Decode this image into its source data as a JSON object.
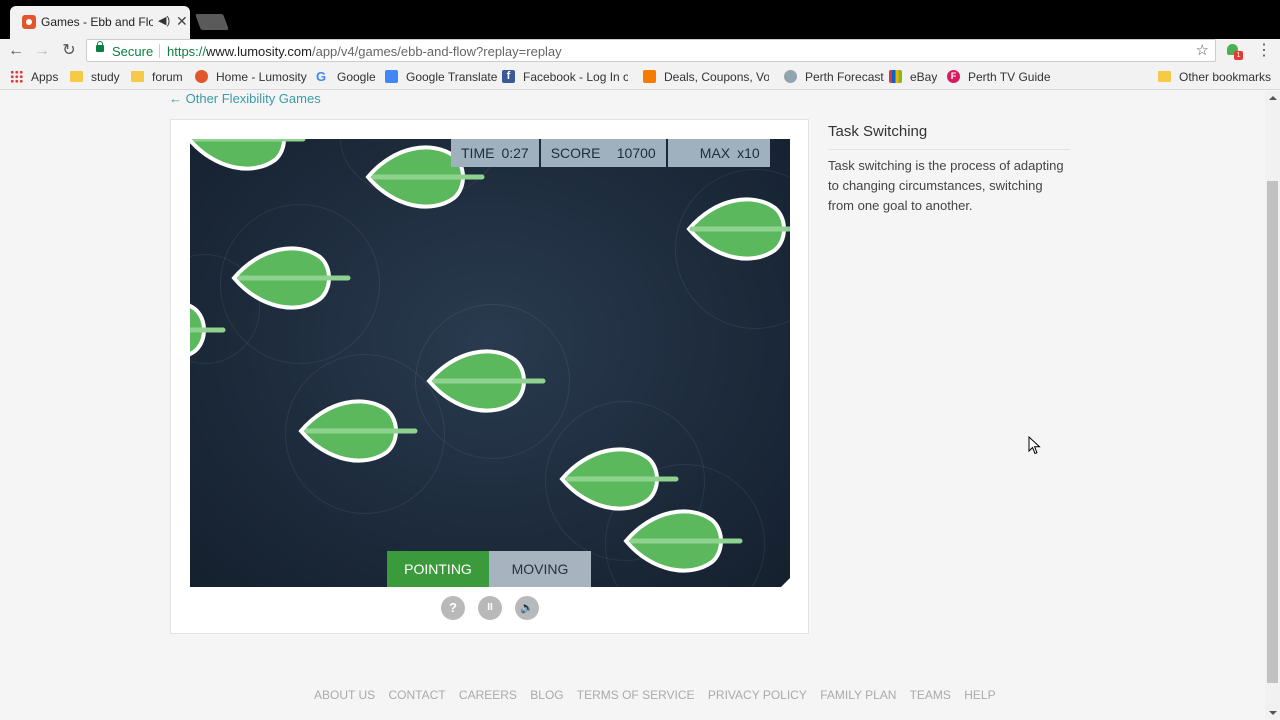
{
  "browser": {
    "tab_title": "Games - Ebb and Flow",
    "tab_audio_icon": "speaker-icon",
    "secure_label": "Secure",
    "url_scheme": "https://",
    "url_host": "www.lumosity.com",
    "url_path": "/app/v4/games/ebb-and-flow?replay=replay",
    "bookmarks": [
      {
        "label": "Apps",
        "icon": "apps"
      },
      {
        "label": "study",
        "icon": "folder"
      },
      {
        "label": "forum",
        "icon": "folder"
      },
      {
        "label": "Home - Lumosity",
        "icon": "lum"
      },
      {
        "label": "Google",
        "icon": "g"
      },
      {
        "label": "Google Translate",
        "icon": "gt"
      },
      {
        "label": "Facebook - Log In or",
        "icon": "fb"
      },
      {
        "label": "Deals, Coupons, Vouc",
        "icon": "oz"
      },
      {
        "label": "Perth Forecast",
        "icon": "perth"
      },
      {
        "label": "eBay",
        "icon": "ebay"
      },
      {
        "label": "Perth TV Guide",
        "icon": "tv"
      }
    ],
    "other_bookmarks": "Other bookmarks",
    "extension_badge": "1"
  },
  "page": {
    "back_link": "← Other Flexibility Games",
    "hud": {
      "time_label": "TIME",
      "time_value": "0:27",
      "score_label": "SCORE",
      "score_value": "10700",
      "max_label": "MAX",
      "max_value": "x10"
    },
    "modes": {
      "pointing": "POINTING",
      "moving": "MOVING"
    },
    "controls": {
      "help": "?",
      "pause": "II",
      "sound": "🔊"
    },
    "side": {
      "title": "Task Switching",
      "description": "Task switching is the process of adapting to changing circumstances, switching from one goal to another."
    },
    "footer": [
      "ABOUT US",
      "CONTACT",
      "CAREERS",
      "BLOG",
      "TERMS OF SERVICE",
      "PRIVACY POLICY",
      "FAMILY PLAN",
      "TEAMS",
      "HELP"
    ]
  },
  "colors": {
    "leaf_green": "#5cb85c",
    "leaf_vein": "#8fd28f",
    "mode_active": "#3b9a3b",
    "link_teal": "#3a9ba5"
  }
}
